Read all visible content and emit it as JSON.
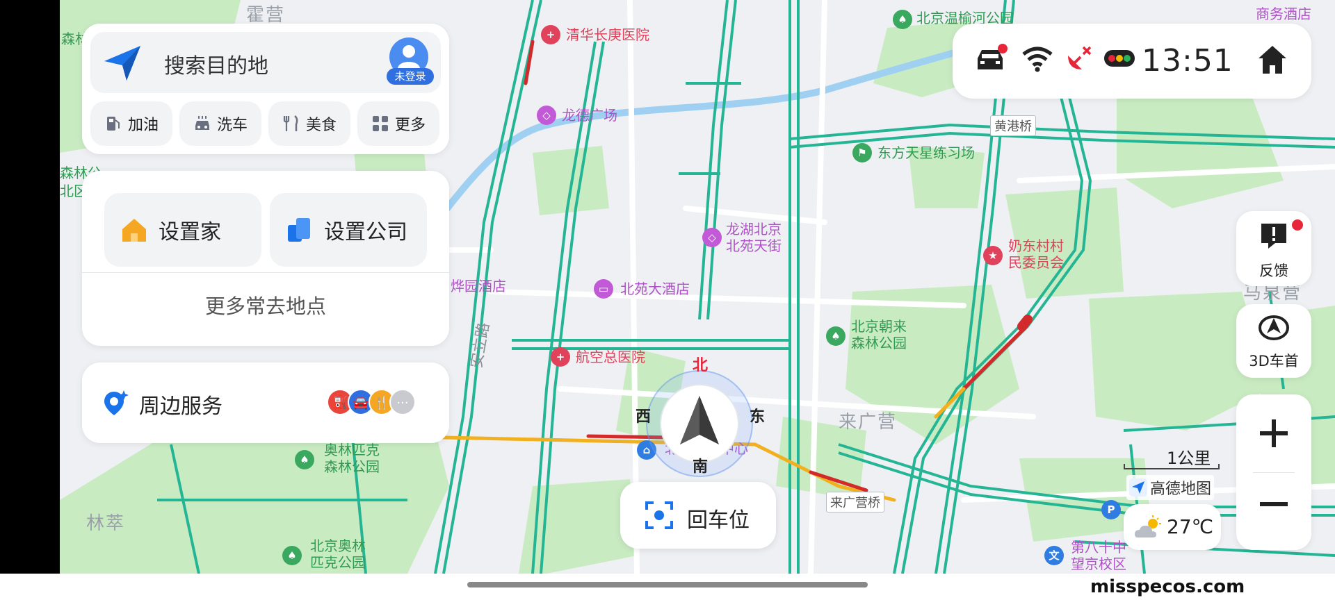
{
  "search": {
    "placeholder": "搜索目的地",
    "login_badge": "未登录",
    "quick_actions": [
      {
        "label": "加油",
        "icon": "fuel-pump-icon"
      },
      {
        "label": "洗车",
        "icon": "car-wash-icon"
      },
      {
        "label": "美食",
        "icon": "fork-knife-icon"
      },
      {
        "label": "更多",
        "icon": "grid-more-icon"
      }
    ]
  },
  "places": {
    "home_label": "设置家",
    "company_label": "设置公司",
    "more_label": "更多常去地点"
  },
  "nearby": {
    "label": "周边服务",
    "icons": [
      "fuel-icon",
      "car-icon",
      "food-icon",
      "more-dots-icon"
    ]
  },
  "status": {
    "time": "13:51",
    "icons": [
      "car-alert-icon",
      "wifi-icon",
      "satellite-off-icon",
      "traffic-light-icon",
      "home-icon"
    ]
  },
  "side_buttons": {
    "feedback_label": "反馈",
    "view_label": "3D车首"
  },
  "compass": {
    "north": "北",
    "south": "南",
    "east": "东",
    "west": "西"
  },
  "recenter_label": "回车位",
  "scale_label": "1公里",
  "map_brand": "高德地图",
  "weather": {
    "temperature": "27℃"
  },
  "watermark": "misspecos.com",
  "map": {
    "pois": {
      "qinghua": "清华长庚医院",
      "longde": "龙德广场",
      "longhu": "龙湖北京\n北苑天街",
      "beiyuan_hotel": "北苑大酒店",
      "hangkong": "航空总医院",
      "huayuan": "烨园酒店",
      "dongfang": "东方天星练习场",
      "naidong": "奶东村村\n民委员会",
      "chaolai": "北京朝来\n森林公园",
      "wenyu": "北京温榆河公园",
      "shangwu": "商务酒店",
      "olympic_forest": "奥林匹克\n森林公园",
      "olympic_park": "北京奥林\n匹克公园",
      "forest_park_top": "森林公园",
      "forest_park_mid": "森林公\n北区",
      "beijing_center": "北京会议中心",
      "school": "第八十中\n望京校区"
    },
    "places": {
      "laiguangying": "来广营",
      "maquanying": "马泉营",
      "lincui": "林萃",
      "qiying": "霍营"
    },
    "roads": {
      "anli": "安立路",
      "huanggang": "黄港桥",
      "laiguangying_bridge": "来广营桥"
    }
  },
  "colors": {
    "accent_blue": "#2f7de0",
    "road_green": "#24b594",
    "traffic_red": "#d22a2a",
    "traffic_yellow": "#f0b020",
    "park_green": "#c8eac0"
  }
}
